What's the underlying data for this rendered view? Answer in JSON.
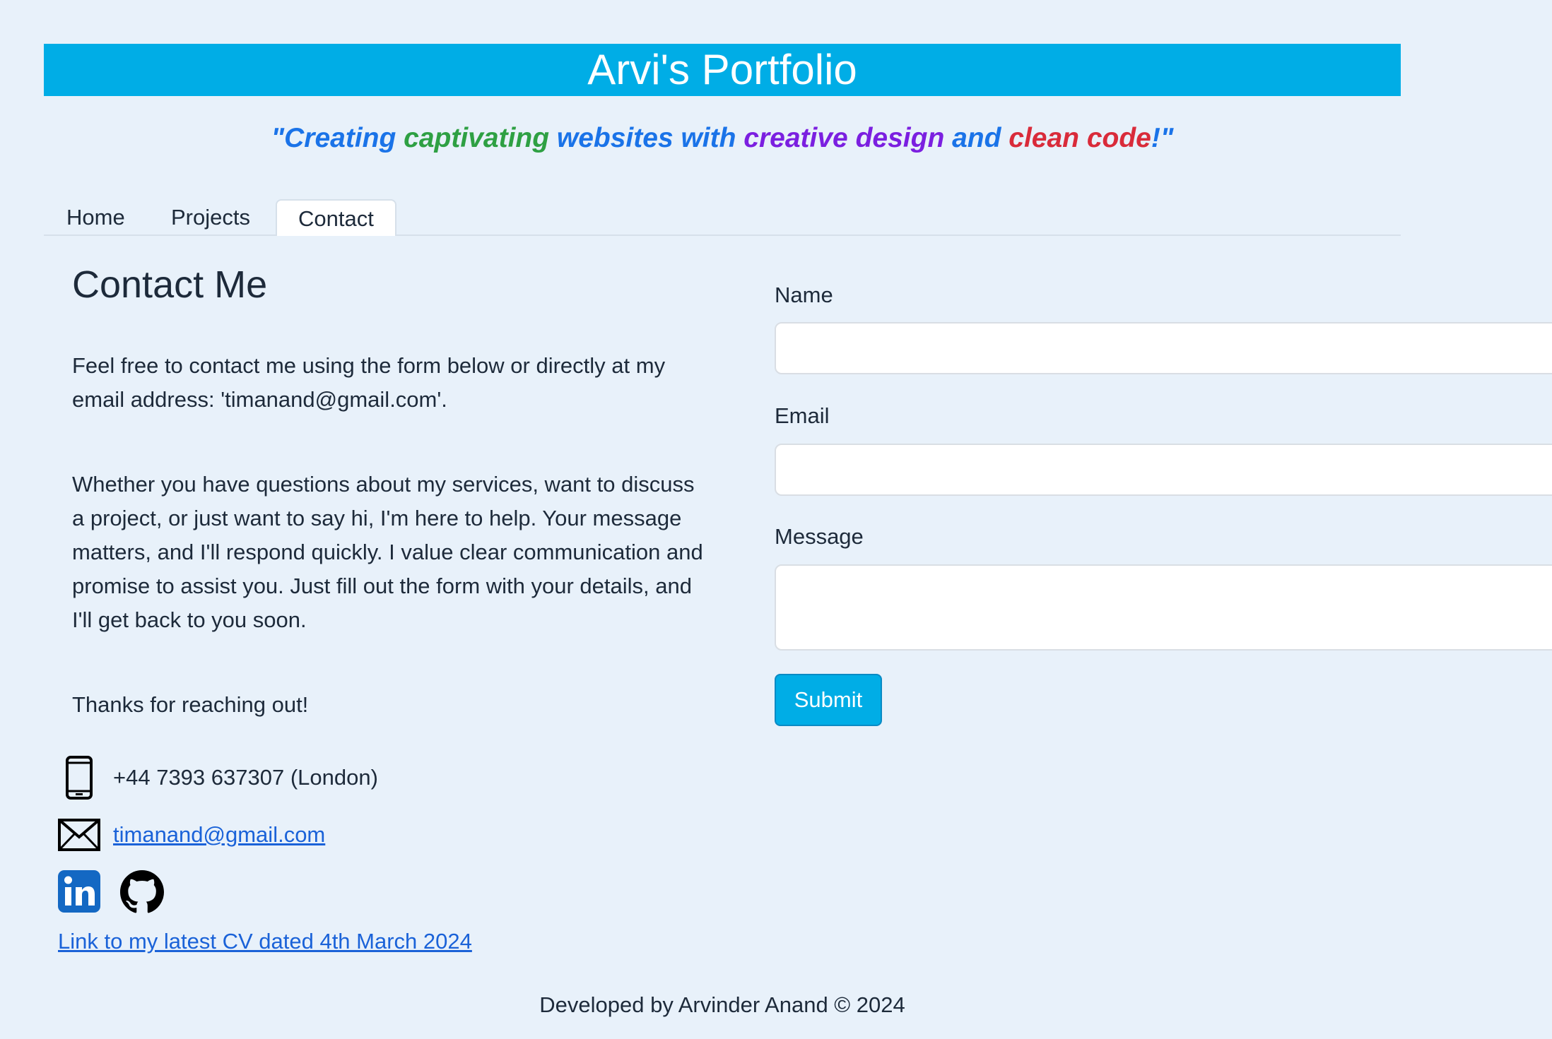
{
  "header": {
    "title": "Arvi's Portfolio",
    "tagline": [
      {
        "text": "\"Creating ",
        "color": "#1a73e8"
      },
      {
        "text": "captivating ",
        "color": "#2ea043"
      },
      {
        "text": "websites with ",
        "color": "#1a73e8"
      },
      {
        "text": "creative design ",
        "color": "#7b1fe0"
      },
      {
        "text": "and ",
        "color": "#1a73e8"
      },
      {
        "text": "clean code",
        "color": "#d92b3a"
      },
      {
        "text": "!\"",
        "color": "#1a73e8"
      }
    ]
  },
  "nav": {
    "tabs": [
      {
        "label": "Home",
        "active": false
      },
      {
        "label": "Projects",
        "active": false
      },
      {
        "label": "Contact",
        "active": true
      }
    ]
  },
  "contact": {
    "heading": "Contact Me",
    "para1": "Feel free to contact me using the form below or directly at my email address: 'timanand@gmail.com'.",
    "para2": "Whether you have questions about my services, want to discuss a project, or just want to say hi, I'm here to help. Your message matters, and I'll respond quickly. I value clear communication and promise to assist you. Just fill out the form with your details, and I'll get back to you soon.",
    "para3": "Thanks for reaching out!",
    "phone": "+44 7393 637307 (London)",
    "phone_icon": "phone-icon",
    "email": "timanand@gmail.com",
    "email_icon": "envelope-icon",
    "social": [
      {
        "name": "linkedin-icon"
      },
      {
        "name": "github-icon"
      }
    ],
    "cv_link": "Link to my latest CV dated 4th March 2024"
  },
  "form": {
    "name_label": "Name",
    "name_value": "",
    "email_label": "Email",
    "email_value": "",
    "message_label": "Message",
    "message_value": "",
    "submit_label": "Submit"
  },
  "footer": {
    "text": "Developed by Arvinder Anand © 2024"
  },
  "colors": {
    "background": "#e8f1fa",
    "accent": "#00ade6",
    "link": "#1a62d8"
  }
}
